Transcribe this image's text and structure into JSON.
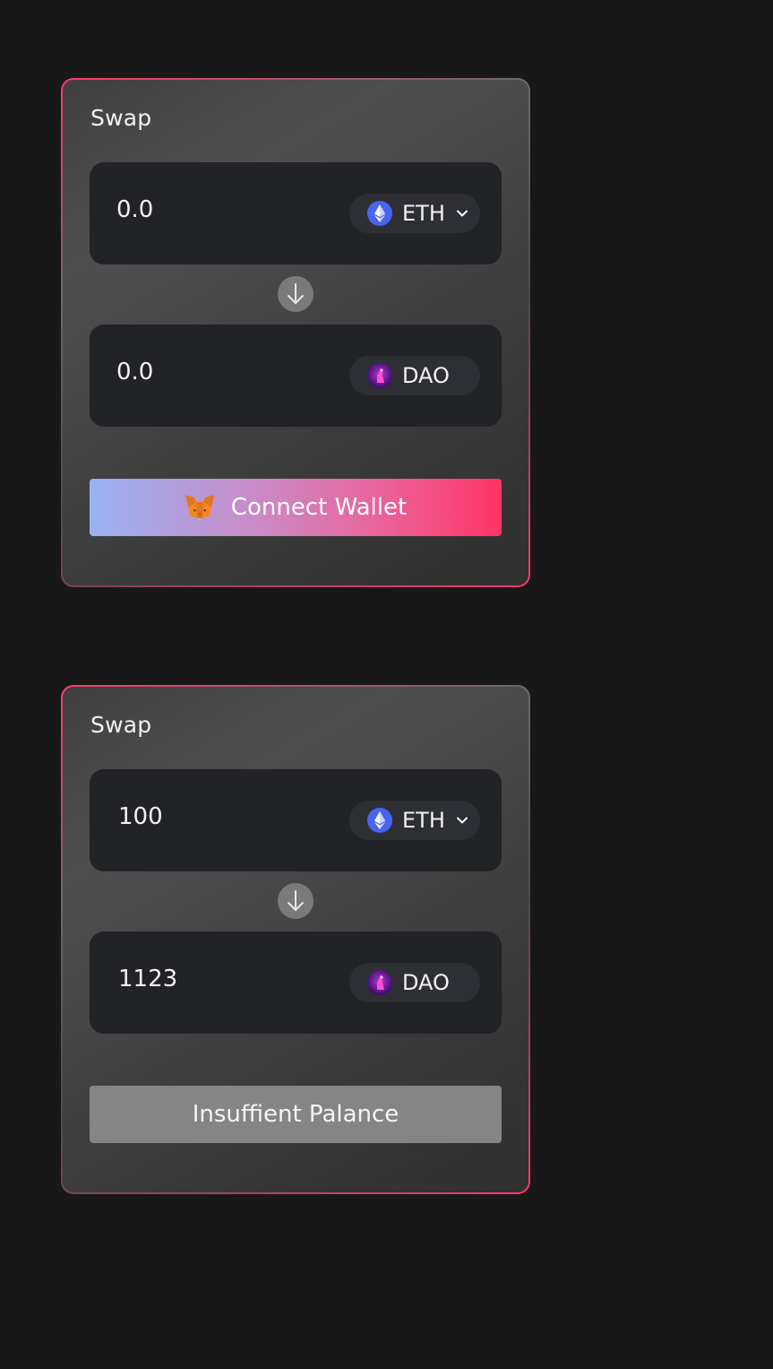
{
  "cards": [
    {
      "title": "Swap",
      "from": {
        "amount": "0.0",
        "token": "ETH",
        "has_dropdown": true,
        "icon": "ethereum-icon"
      },
      "to": {
        "amount": "0.0",
        "token": "DAO",
        "has_dropdown": false,
        "icon": "dao-token-icon"
      },
      "button": {
        "label": "Connect Wallet",
        "icon": "metamask-fox-icon",
        "style": "gradient"
      }
    },
    {
      "title": "Swap",
      "from": {
        "amount": "100",
        "token": "ETH",
        "has_dropdown": true,
        "icon": "ethereum-icon"
      },
      "to": {
        "amount": "1123",
        "token": "DAO",
        "has_dropdown": false,
        "icon": "dao-token-icon"
      },
      "button": {
        "label": "Insuffient Palance",
        "style": "disabled-gray"
      }
    }
  ],
  "colors": {
    "page_background": "#181818",
    "accent_pink": "#ff3464",
    "accent_blue": "#98b2f4",
    "ethereum_blue": "#4a64f0",
    "dao_purple": "#6a1aa0"
  }
}
